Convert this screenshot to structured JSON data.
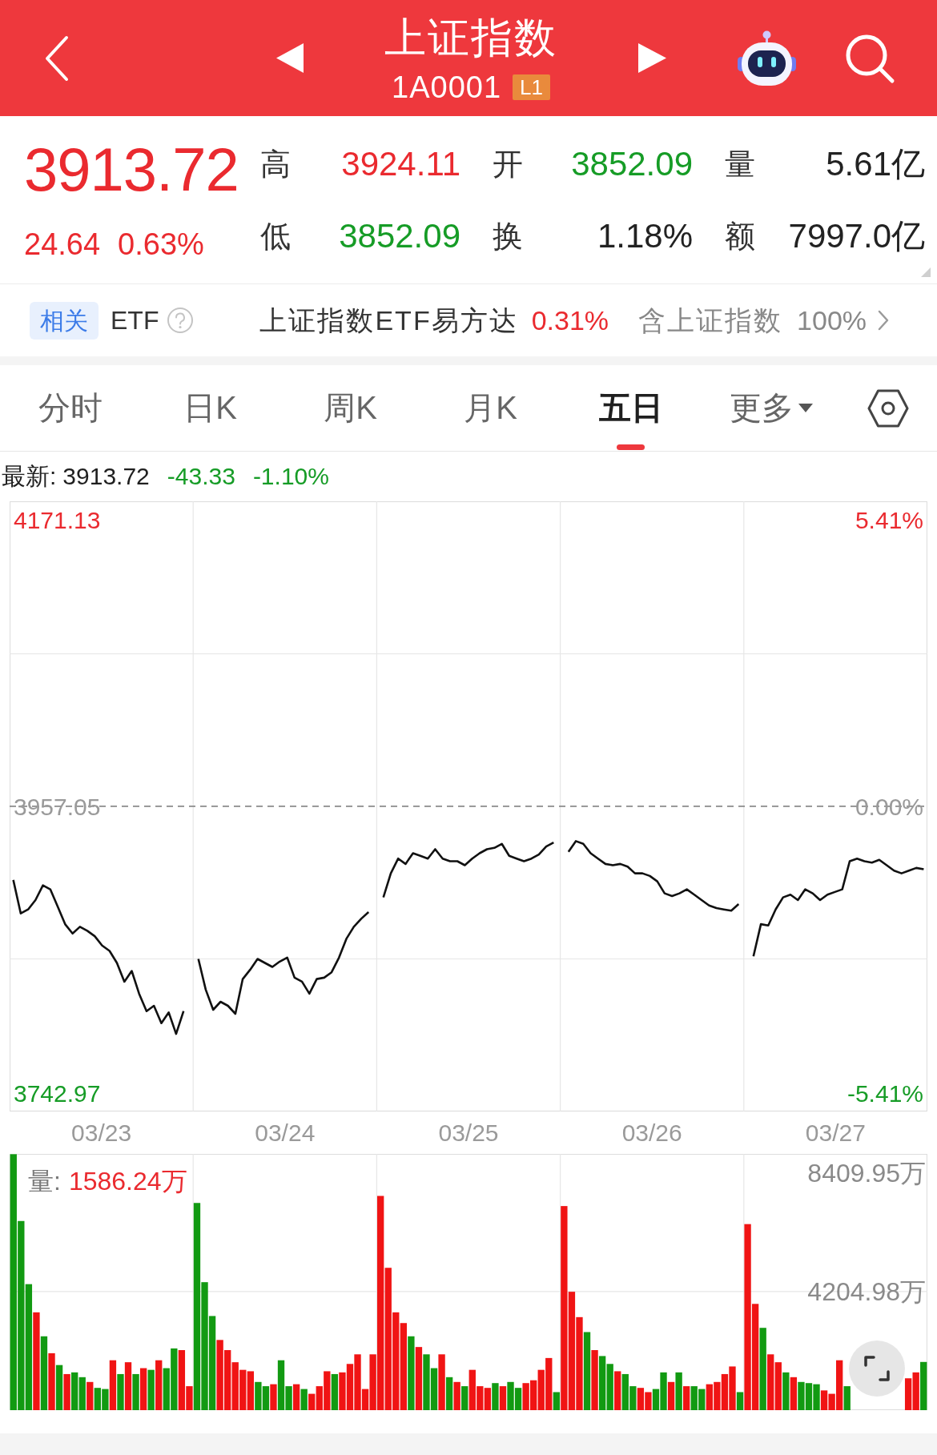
{
  "header": {
    "title": "上证指数",
    "code": "1A0001",
    "level_badge": "L1"
  },
  "quote": {
    "price": "3913.72",
    "change": "24.64",
    "change_pct": "0.63%",
    "color": "#ea2a2f",
    "stats": [
      {
        "label": "高",
        "value": "3924.11",
        "color": "#ea2a2f"
      },
      {
        "label": "开",
        "value": "3852.09",
        "color": "#169c26"
      },
      {
        "label": "量",
        "value": "5.61亿",
        "color": "#222222"
      },
      {
        "label": "低",
        "value": "3852.09",
        "color": "#169c26"
      },
      {
        "label": "换",
        "value": "1.18%",
        "color": "#222222"
      },
      {
        "label": "额",
        "value": "7997.0亿",
        "color": "#222222"
      }
    ]
  },
  "etf_bar": {
    "tag": "相关",
    "label": "ETF",
    "fund_name": "上证指数ETF易方达",
    "fund_change": {
      "text": "0.31%",
      "color": "#ea2a2f"
    },
    "holding_label": "含上证指数",
    "holding_share": "100%"
  },
  "chart_tabs": [
    {
      "label": "分时",
      "selected": false,
      "kind": "tab"
    },
    {
      "label": "日K",
      "selected": false,
      "kind": "tab"
    },
    {
      "label": "周K",
      "selected": false,
      "kind": "tab"
    },
    {
      "label": "月K",
      "selected": false,
      "kind": "tab"
    },
    {
      "label": "五日",
      "selected": true,
      "kind": "tab"
    },
    {
      "label": "更多",
      "selected": false,
      "kind": "menu"
    }
  ],
  "latest": {
    "label": "最新:",
    "price": "3913.72",
    "change": {
      "text": "-43.33",
      "color": "#169c26"
    },
    "change_pct": {
      "text": "-1.10%",
      "color": "#169c26"
    }
  },
  "price_chart": {
    "date_labels": [
      "03/23",
      "03/24",
      "03/25",
      "03/26",
      "03/27"
    ],
    "chart_data": {
      "type": "line",
      "ylim": [
        3729,
        4185
      ],
      "yticks": [
        {
          "value": 4171.13,
          "label": "4171.13"
        },
        {
          "value": 3957.05,
          "label": "3957.05"
        },
        {
          "value": 3742.97,
          "label": "3742.97"
        }
      ],
      "values": [
        3902,
        3877,
        3880,
        3887,
        3898,
        3895,
        3882,
        3869,
        3862,
        3867,
        3864,
        3860,
        3853,
        3849,
        3840,
        3826,
        3834,
        3817,
        3804,
        3808,
        3795,
        3803,
        3787,
        3804,
        null,
        3843,
        3820,
        3805,
        3811,
        3808,
        3802,
        3828,
        3835,
        3843,
        3840,
        3837,
        3841,
        3844,
        3829,
        3826,
        3817,
        3828,
        3829,
        3833,
        3844,
        3858,
        3867,
        3873,
        3878,
        null,
        3889,
        3907,
        3918,
        3914,
        3922,
        3920,
        3918,
        3925,
        3918,
        3916,
        3916,
        3913,
        3918,
        3922,
        3925,
        3926,
        3929,
        3920,
        3918,
        3916,
        3918,
        3921,
        3927,
        3930,
        null,
        3923,
        3931,
        3929,
        3922,
        3918,
        3914,
        3913,
        3914,
        3912,
        3907,
        3907,
        3905,
        3901,
        3892,
        3890,
        3892,
        3895,
        3891,
        3887,
        3883,
        3881,
        3880,
        3879,
        3884,
        null,
        3845,
        3869,
        3868,
        3880,
        3889,
        3891,
        3887,
        3895,
        3892,
        3887,
        3891,
        3893,
        3895,
        3916,
        3918,
        3916,
        3915,
        3917,
        3913,
        3909,
        3907,
        3909,
        3911,
        3910
      ],
      "ref_lines": [
        {
          "axis": "y",
          "value": 3957.05
        }
      ],
      "annotations": [
        "5.41%",
        "0.00%",
        "-5.41%"
      ]
    }
  },
  "volume_chart": {
    "readout": {
      "label": "量:",
      "value": "1586.24万"
    },
    "chart_data": {
      "type": "bar",
      "ylim": [
        0,
        9090
      ],
      "yticks": [
        {
          "value": 8409.95,
          "label": "8409.95万"
        },
        {
          "value": 4204.98,
          "label": "4204.98万"
        }
      ],
      "series": [
        {
          "color": "#f01414",
          "values": [
            null,
            null,
            null,
            3470,
            null,
            2020,
            null,
            1280,
            null,
            null,
            1000,
            null,
            null,
            1770,
            null,
            1700,
            null,
            1490,
            null,
            1770,
            null,
            null,
            2130,
            850,
            null,
            null,
            null,
            2490,
            2130,
            1700,
            1430,
            1380,
            null,
            null,
            920,
            null,
            null,
            920,
            null,
            580,
            850,
            1380,
            null,
            1340,
            1640,
            1980,
            750,
            1980,
            7600,
            5050,
            3470,
            3090,
            null,
            2240,
            null,
            null,
            1980,
            null,
            1000,
            null,
            1430,
            850,
            790,
            null,
            850,
            null,
            null,
            960,
            1060,
            1430,
            1850,
            null,
            7240,
            4200,
            3300,
            null,
            2130,
            null,
            null,
            1380,
            null,
            null,
            790,
            640,
            null,
            null,
            1000,
            null,
            850,
            null,
            null,
            920,
            1000,
            1280,
            1550,
            null,
            6600,
            3770,
            null,
            1980,
            1700,
            null,
            1170,
            null,
            null,
            null,
            700,
            580,
            1770,
            null,
            null,
            null,
            null,
            null,
            null,
            null,
            null,
            1130,
            1340,
            null
          ]
        },
        {
          "color": "#129a12",
          "values": [
            9080,
            6710,
            4470,
            null,
            2620,
            null,
            1600,
            null,
            1340,
            1170,
            null,
            790,
            750,
            null,
            1280,
            null,
            1280,
            null,
            1430,
            null,
            1490,
            2190,
            null,
            null,
            7350,
            4540,
            3340,
            null,
            null,
            null,
            null,
            null,
            1000,
            850,
            null,
            1770,
            850,
            null,
            750,
            null,
            null,
            null,
            1280,
            null,
            null,
            null,
            null,
            null,
            null,
            null,
            null,
            null,
            2620,
            null,
            1980,
            1490,
            null,
            1170,
            null,
            850,
            null,
            null,
            null,
            960,
            null,
            1000,
            790,
            null,
            null,
            null,
            null,
            640,
            null,
            null,
            null,
            2770,
            null,
            1920,
            1640,
            null,
            1280,
            850,
            null,
            null,
            750,
            1340,
            null,
            1340,
            null,
            850,
            750,
            null,
            null,
            null,
            null,
            640,
            null,
            null,
            2920,
            null,
            null,
            1340,
            null,
            1000,
            960,
            920,
            null,
            null,
            null,
            850,
            null,
            null,
            null,
            null,
            null,
            null,
            null,
            null,
            null,
            1710
          ]
        }
      ]
    }
  }
}
